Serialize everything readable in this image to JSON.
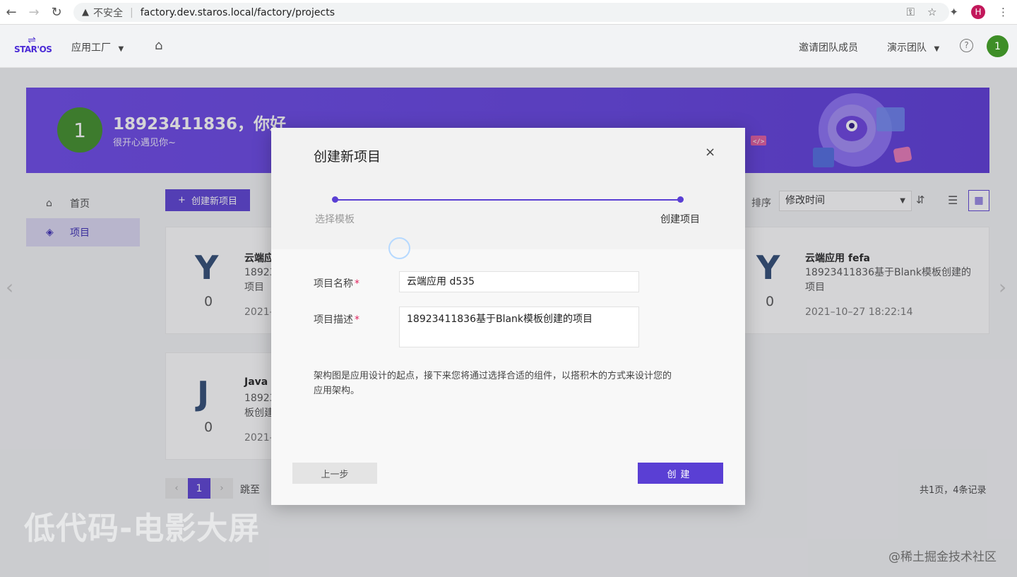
{
  "browser": {
    "insecure_label": "不安全",
    "url": "factory.dev.staros.local/factory/projects",
    "profile_initial": "H"
  },
  "header": {
    "logo_text": "STAR'OS",
    "app_menu": "应用工厂",
    "invite": "邀请团队成员",
    "team": "演示团队",
    "help": "?",
    "avatar_initial": "1"
  },
  "banner": {
    "avatar_initial": "1",
    "greeting": "18923411836，你好",
    "subtitle": "很开心遇见你~"
  },
  "sidebar": {
    "items": [
      {
        "label": "首页",
        "icon": "home-icon"
      },
      {
        "label": "项目",
        "icon": "layers-icon"
      }
    ]
  },
  "toolbar": {
    "create_label": "创建新项目",
    "sort_label": "排序",
    "sort_value": "修改时间"
  },
  "cards": [
    {
      "letter": "Y",
      "count": "0",
      "title": "云端应",
      "desc1": "18923",
      "desc2": "项目",
      "date": "2021–"
    },
    {
      "letter": "Y",
      "count": "0",
      "title": "云端应用 fefa",
      "desc1": "18923411836基于Blank模板创建的",
      "desc2": "项目",
      "date": "2021–10–27 18:22:14"
    },
    {
      "letter": "J",
      "count": "0",
      "title": "Java -",
      "desc1": "18923",
      "desc2": "板创建",
      "date": "2021–"
    }
  ],
  "pagination": {
    "current": "1",
    "jump_label": "跳至",
    "total": "共1页，4条记录"
  },
  "modal": {
    "title": "创建新项目",
    "close": "×",
    "step1": "选择模板",
    "step2": "创建项目",
    "name_label": "项目名称",
    "name_value": "云端应用 d535",
    "desc_label": "项目描述",
    "desc_value": "18923411836基于Blank模板创建的项目",
    "required_mark": "*",
    "info_line1": "架构图是应用设计的起点，接下来您将通过选择合适的组件，以搭积木的方式来设计您的",
    "info_line2": "应用架构。",
    "prev_label": "上一步",
    "create_label": "创建"
  },
  "watermark": "低代码-电影大屏",
  "source_watermark": "@稀土掘金技术社区",
  "colors": {
    "accent": "#5a3fd4",
    "avatar": "#3e8e27"
  }
}
